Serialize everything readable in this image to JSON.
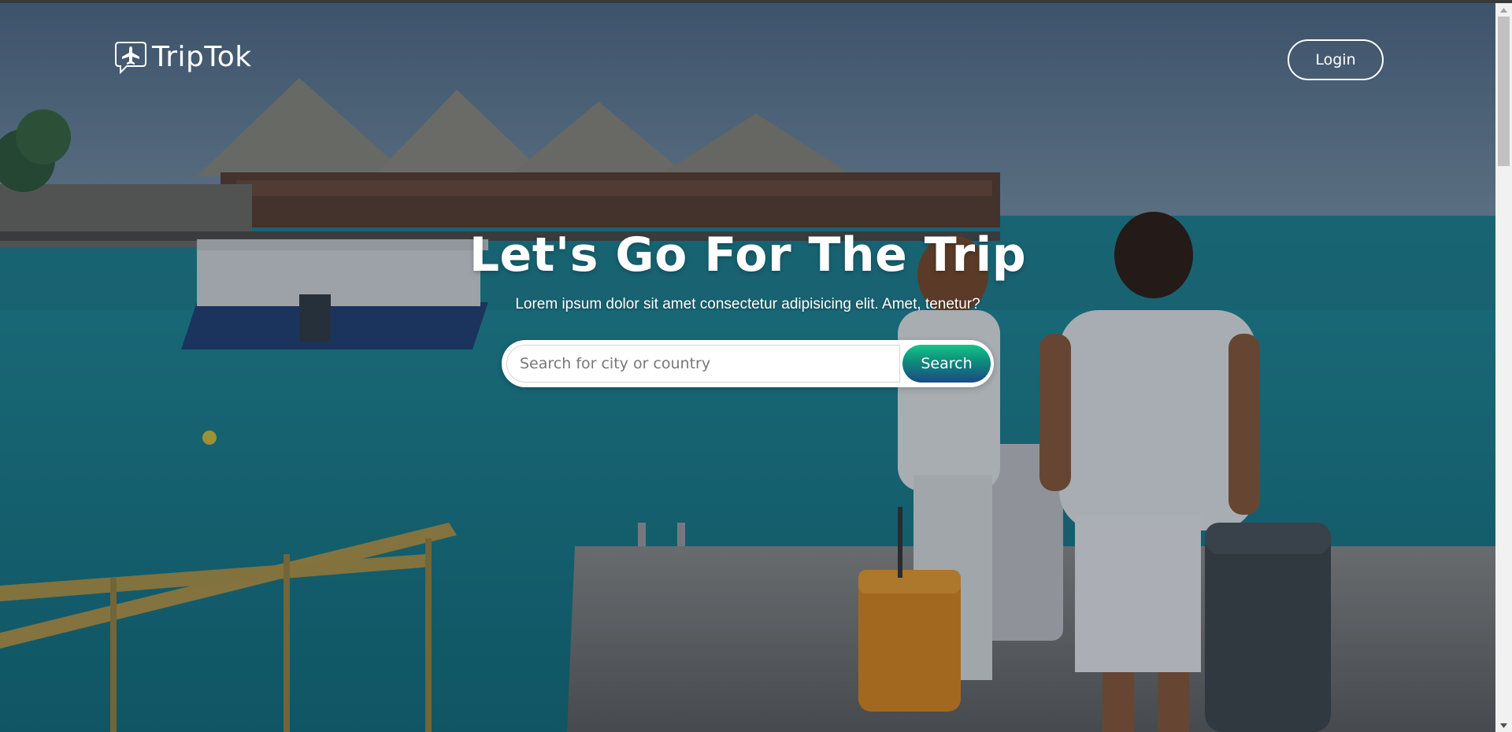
{
  "brand": {
    "name": "TripTok",
    "icon": "plane-chat-icon"
  },
  "nav": {
    "login_label": "Login"
  },
  "hero": {
    "title": "Let's Go For The Trip",
    "subtitle": "Lorem ipsum dolor sit amet consectetur adipisicing elit. Amet, tenetur?"
  },
  "search": {
    "placeholder": "Search for city or country",
    "value": "",
    "button_label": "Search"
  },
  "colors": {
    "accent_top": "#12c78a",
    "accent_bottom": "#1a4a86",
    "text": "#ffffff"
  },
  "scrollbar": {
    "up_icon": "triangle-up-icon",
    "down_icon": "triangle-down-icon"
  }
}
